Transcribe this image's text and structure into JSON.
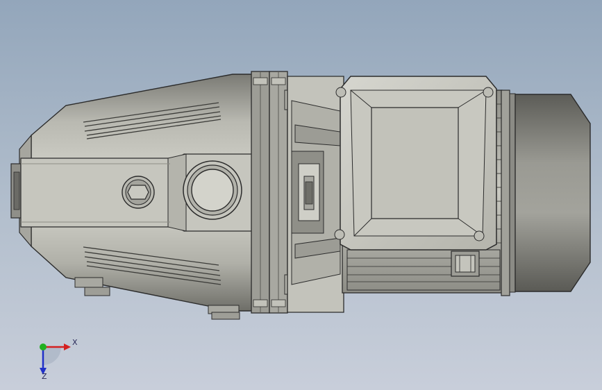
{
  "triad": {
    "x_label": "X",
    "z_label": "Z",
    "colors": {
      "x": "#d42020",
      "y": "#20b020",
      "z": "#2030c8"
    }
  },
  "model": {
    "body_color": "#b8b8b0",
    "edge_color": "#2b2b2b",
    "shadow_color": "#6e6e68"
  }
}
